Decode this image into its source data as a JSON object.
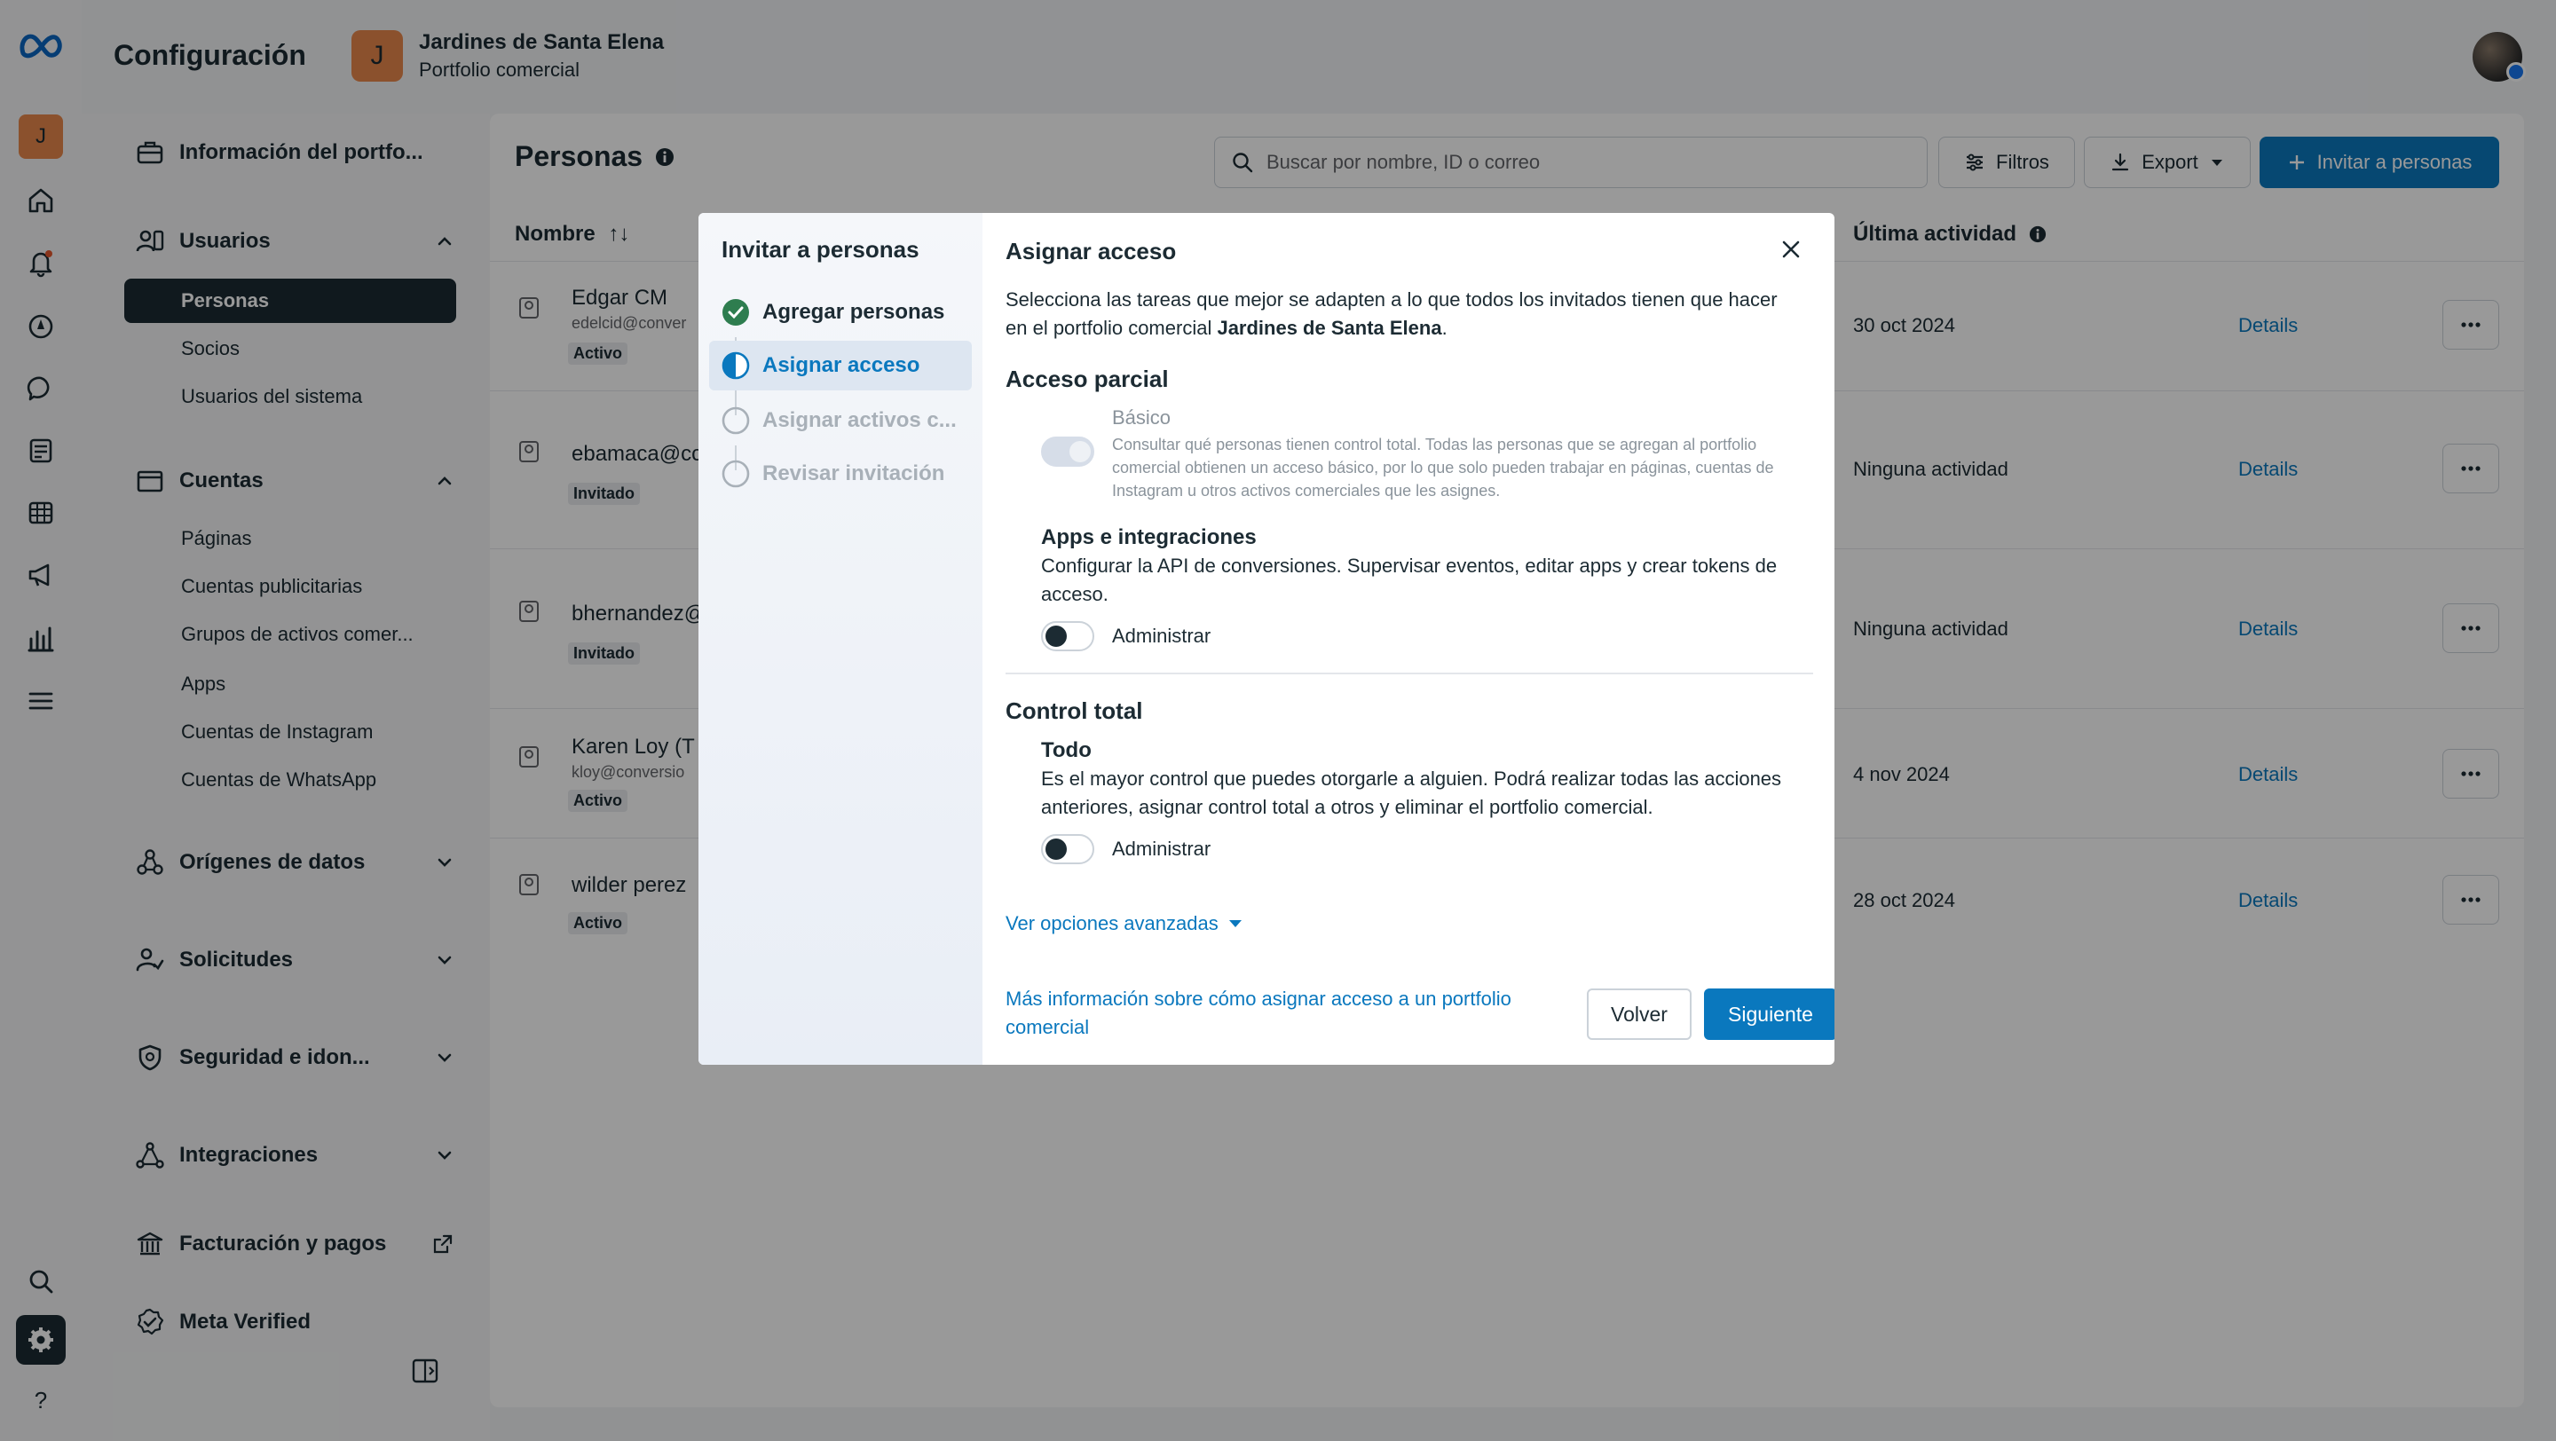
{
  "app": {
    "title": "Configuración",
    "business_initial": "J",
    "business_name": "Jardines de Santa Elena",
    "business_type": "Portfolio comercial"
  },
  "rail": {
    "avatar_initial": "J",
    "icons": [
      "meta-logo-icon",
      "home-icon",
      "notifications-icon",
      "compass-icon",
      "chat-icon",
      "pages-icon",
      "table-icon",
      "megaphone-icon",
      "bar-chart-icon",
      "menu-icon",
      "search-icon",
      "settings-icon",
      "help-icon"
    ]
  },
  "sidebar": {
    "info": "Información del portfo...",
    "users": "Usuarios",
    "users_items": [
      "Personas",
      "Socios",
      "Usuarios del sistema"
    ],
    "accounts": "Cuentas",
    "accounts_items": [
      "Páginas",
      "Cuentas publicitarias",
      "Grupos de activos comer...",
      "Apps",
      "Cuentas de Instagram",
      "Cuentas de WhatsApp"
    ],
    "data_sources": "Orígenes de datos",
    "requests": "Solicitudes",
    "security": "Seguridad e idon...",
    "integrations": "Integraciones",
    "billing": "Facturación y pagos",
    "verified": "Meta Verified"
  },
  "main": {
    "title": "Personas",
    "search_placeholder": "Buscar por nombre, ID o correo",
    "filters": "Filtros",
    "export": "Export",
    "invite": "Invitar a personas",
    "col_name": "Nombre",
    "col_sort": "↑↓",
    "col_activity": "Última actividad",
    "details_label": "Details",
    "rows": [
      {
        "name": "Edgar CM",
        "email": "edelcid@conver",
        "status": "Activo",
        "activity": "30 oct 2024"
      },
      {
        "name": "ebamaca@cc",
        "email": "",
        "status": "Invitado",
        "activity": "Ninguna actividad"
      },
      {
        "name": "bhernandez@",
        "email": "",
        "status": "Invitado",
        "activity": "Ninguna actividad"
      },
      {
        "name": "Karen Loy (T",
        "email": "kloy@conversio",
        "status": "Activo",
        "activity": "4 nov 2024"
      },
      {
        "name": "wilder perez",
        "email": "",
        "status": "Activo",
        "activity": "28 oct 2024"
      }
    ]
  },
  "modal": {
    "steps_title": "Invitar a personas",
    "steps": [
      {
        "label": "Agregar personas",
        "state": "done"
      },
      {
        "label": "Asignar acceso",
        "state": "current"
      },
      {
        "label": "Asignar activos c...",
        "state": "pending"
      },
      {
        "label": "Revisar invitación",
        "state": "pending"
      }
    ],
    "title": "Asignar acceso",
    "desc_prefix": "Selecciona las tareas que mejor se adapten a lo que todos los invitados tienen que hacer en el portfolio comercial ",
    "desc_business": "Jardines de Santa Elena",
    "desc_suffix": ".",
    "partial_title": "Acceso parcial",
    "basic_label": "Básico",
    "basic_desc": "Consultar qué personas tienen control total. Todas las personas que se agregan al portfolio comercial obtienen un acceso básico, por lo que solo pueden trabajar en páginas, cuentas de Instagram u otros activos comerciales que les asignes.",
    "apps_title": "Apps e integraciones",
    "apps_desc": "Configurar la API de conversiones. Supervisar eventos, editar apps y crear tokens de acceso.",
    "admin_label": "Administrar",
    "full_title": "Control total",
    "all_title": "Todo",
    "all_desc": "Es el mayor control que puedes otorgarle a alguien. Podrá realizar todas las acciones anteriores, asignar control total a otros y eliminar el portfolio comercial.",
    "advanced": "Ver opciones avanzadas",
    "help_link": "Más información sobre cómo asignar acceso a un portfolio comercial",
    "back": "Volver",
    "next": "Siguiente"
  },
  "colors": {
    "accent": "#0a78be",
    "dark": "#1c2b33",
    "success": "#2e7d4f",
    "avatar": "#e8884b"
  }
}
